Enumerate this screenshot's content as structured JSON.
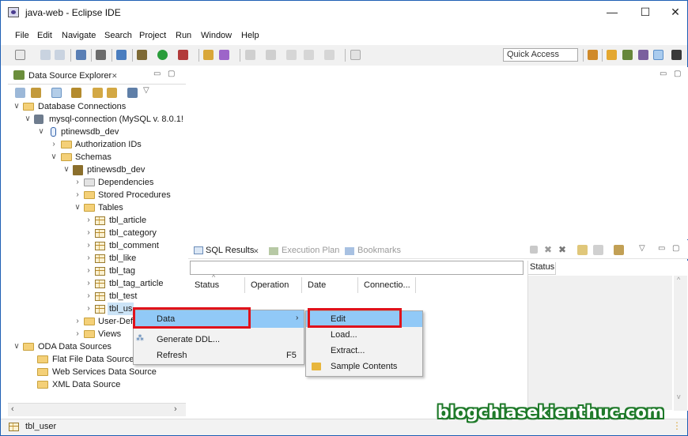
{
  "window": {
    "title": "java-web - Eclipse IDE",
    "min": "—",
    "max": "☐",
    "close": "✕"
  },
  "menu": [
    "File",
    "Edit",
    "Navigate",
    "Search",
    "Project",
    "Run",
    "Window",
    "Help"
  ],
  "toolbar": {
    "quick_access": "Quick Access"
  },
  "explorer": {
    "title": "Data Source Explorer",
    "tab_close": "✕",
    "tree": {
      "db_connections": "Database Connections",
      "connection": "mysql-connection (MySQL v. 8.0.1!",
      "database": "ptinewsdb_dev",
      "auth_ids": "Authorization IDs",
      "schemas": "Schemas",
      "schema": "ptinewsdb_dev",
      "dependencies": "Dependencies",
      "stored_procedures": "Stored Procedures",
      "tables": "Tables",
      "table_items": [
        "tbl_article",
        "tbl_category",
        "tbl_comment",
        "tbl_like",
        "tbl_tag",
        "tbl_tag_article",
        "tbl_test",
        "tbl_us"
      ],
      "user_defined": "User-Defi",
      "views": "Views",
      "oda_sources": "ODA Data Sources",
      "flat_file": "Flat File Data Source",
      "web_services": "Web Services Data Source",
      "xml_source": "XML Data Source"
    }
  },
  "results": {
    "tabs": [
      "SQL Results",
      "Execution Plan",
      "Bookmarks"
    ],
    "columns": [
      "Status",
      "Operation",
      "Date",
      "Connectio..."
    ],
    "right_status": "Status"
  },
  "context_menu": {
    "data": "Data",
    "generate_ddl": "Generate DDL...",
    "refresh": "Refresh",
    "refresh_key": "F5",
    "submenu": [
      "Edit",
      "Load...",
      "Extract...",
      "Sample Contents"
    ]
  },
  "statusbar": {
    "selection": "tbl_user"
  },
  "watermark": "blogchiasekienthuc.com"
}
